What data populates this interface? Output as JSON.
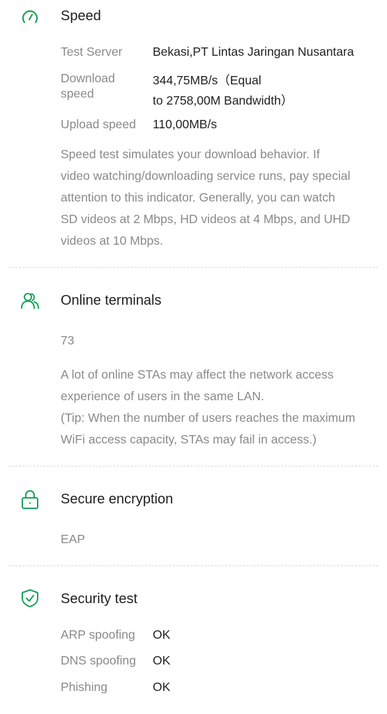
{
  "colors": {
    "accent": "#1aa35a",
    "label": "#8a8a8a",
    "text": "#222222"
  },
  "speed": {
    "icon": "speedometer-icon",
    "title": "Speed",
    "test_server_label": "Test Server",
    "test_server_value": "Bekasi,PT Lintas Jaringan Nusantara",
    "download_label_line1": "Download",
    "download_label_line2": "speed",
    "download_value_line1": "344,75MB/s（Equal",
    "download_value_line2": "to 2758,00M Bandwidth）",
    "upload_label": "Upload speed",
    "upload_value": "110,00MB/s",
    "description_lines": [
      "Speed test simulates your download behavior. If",
      "video watching/downloading service runs, pay special",
      "attention to this indicator. Generally, you can watch",
      "SD videos at 2 Mbps, HD videos at 4 Mbps, and UHD",
      "videos at 10 Mbps."
    ]
  },
  "terminals": {
    "icon": "users-icon",
    "title": "Online terminals",
    "count": "73",
    "description_lines": [
      "A lot of online STAs may affect the network access",
      "experience of users in the same LAN.",
      "(Tip: When the number of users reaches the maximum",
      "WiFi access capacity, STAs may fail in access.)"
    ]
  },
  "encryption": {
    "icon": "lock-icon",
    "title": "Secure encryption",
    "value": "EAP"
  },
  "security": {
    "icon": "shield-check-icon",
    "title": "Security test",
    "arp_label": "ARP spoofing",
    "arp_value": "OK",
    "dns_label": "DNS spoofing",
    "dns_value": "OK",
    "phishing_label": "Phishing",
    "phishing_value": "OK"
  }
}
